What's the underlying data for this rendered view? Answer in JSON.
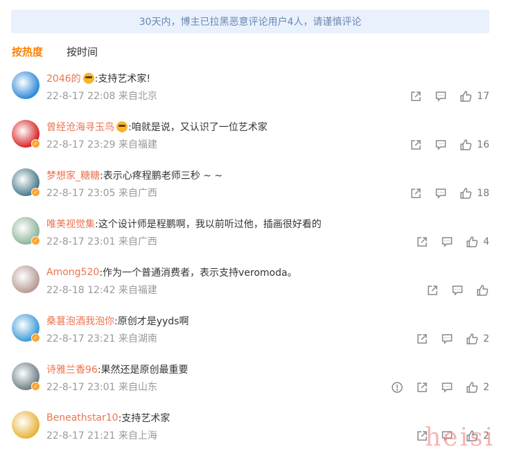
{
  "notice": "30天内，博主已拉黑恶意评论用户4人，请谨慎评论",
  "sort": {
    "hot": "按热度",
    "time": "按时间"
  },
  "comments": [
    {
      "user": "2046的",
      "emoji": true,
      "text": ":支持艺术家!",
      "time": "22-8-17 22:08",
      "location": "来自北京",
      "likes": "17",
      "report": false,
      "verified": false,
      "avatar_color": "#2f89d8"
    },
    {
      "user": "曾经沧海寻玉鸟",
      "emoji": true,
      "text": ":咱就是说，又认识了一位艺术家",
      "time": "22-8-17 23:29",
      "location": "来自福建",
      "likes": "16",
      "report": false,
      "verified": true,
      "avatar_color": "#d8262a"
    },
    {
      "user": "梦想家_糖糖",
      "emoji": false,
      "text": ":表示心疼程鹏老师三秒 ~ ~",
      "time": "22-8-17 23:05",
      "location": "来自广西",
      "likes": "18",
      "report": false,
      "verified": true,
      "avatar_color": "#4b7a8c"
    },
    {
      "user": "唯美视觉集",
      "emoji": false,
      "text": ":这个设计师是程鹏啊，我以前听过他，插画很好看的",
      "time": "22-8-17 23:01",
      "location": "来自广西",
      "likes": "4",
      "report": false,
      "verified": true,
      "avatar_color": "#8fb59a"
    },
    {
      "user": "Among520",
      "emoji": false,
      "text": ":作为一个普通消费者，表示支持veromoda。",
      "time": "22-8-18 12:42",
      "location": "来自福建",
      "likes": "",
      "report": false,
      "verified": false,
      "avatar_color": "#b79b94"
    },
    {
      "user": "桑葚泡酒我泡你",
      "emoji": false,
      "text": ":原创才是yyds啊",
      "time": "22-8-17 23:21",
      "location": "来自湖南",
      "likes": "2",
      "report": false,
      "verified": true,
      "avatar_color": "#3c9ad6"
    },
    {
      "user": "诗雅兰香96",
      "emoji": false,
      "text": ":果然还是原创最重要",
      "time": "22-8-17 23:01",
      "location": "来自山东",
      "likes": "2",
      "report": true,
      "verified": true,
      "avatar_color": "#6e7f86"
    },
    {
      "user": "Beneathstar10",
      "emoji": false,
      "text": ":支持艺术家",
      "time": "22-8-17 21:21",
      "location": "来自上海",
      "likes": "2",
      "report": false,
      "verified": false,
      "avatar_color": "#e7b43a"
    }
  ],
  "icons": {
    "share": "share-icon",
    "comment": "comment-icon",
    "like": "thumbs-up-icon",
    "report": "report-icon"
  },
  "watermark": "heisi"
}
